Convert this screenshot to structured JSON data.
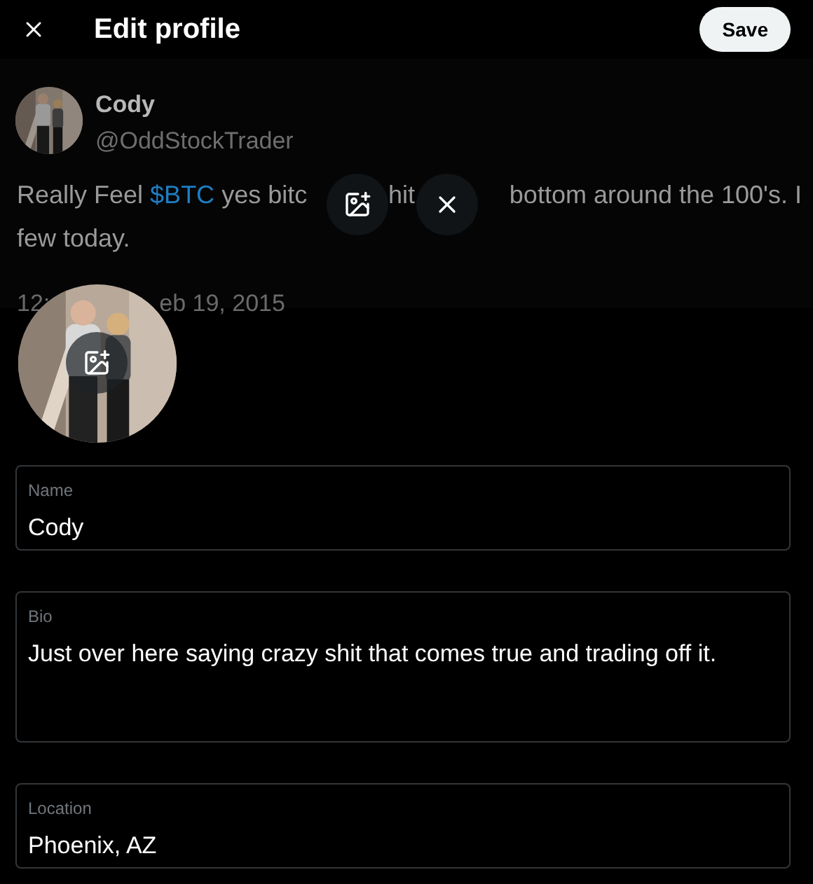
{
  "header": {
    "title": "Edit profile",
    "save_label": "Save"
  },
  "banner": {
    "author_name": "Cody",
    "author_handle": "@OddStockTrader",
    "line_1_start": {
      "before": "Really Feel ",
      "cashtag": "$BTC",
      "after": " yes bitc"
    },
    "line_1_middle": "hit",
    "line_1_end": "bottom around the 100's. I",
    "line_2": "few today.",
    "date_start": "12:",
    "date_end": "eb 19, 2015"
  },
  "fields": [
    {
      "kind": "single",
      "label": "Name",
      "value": "Cody"
    },
    {
      "kind": "multi",
      "label": "Bio",
      "value": "Just over here saying crazy shit that comes true and trading off it."
    },
    {
      "kind": "single",
      "label": "Location",
      "value": "Phoenix, AZ"
    }
  ]
}
